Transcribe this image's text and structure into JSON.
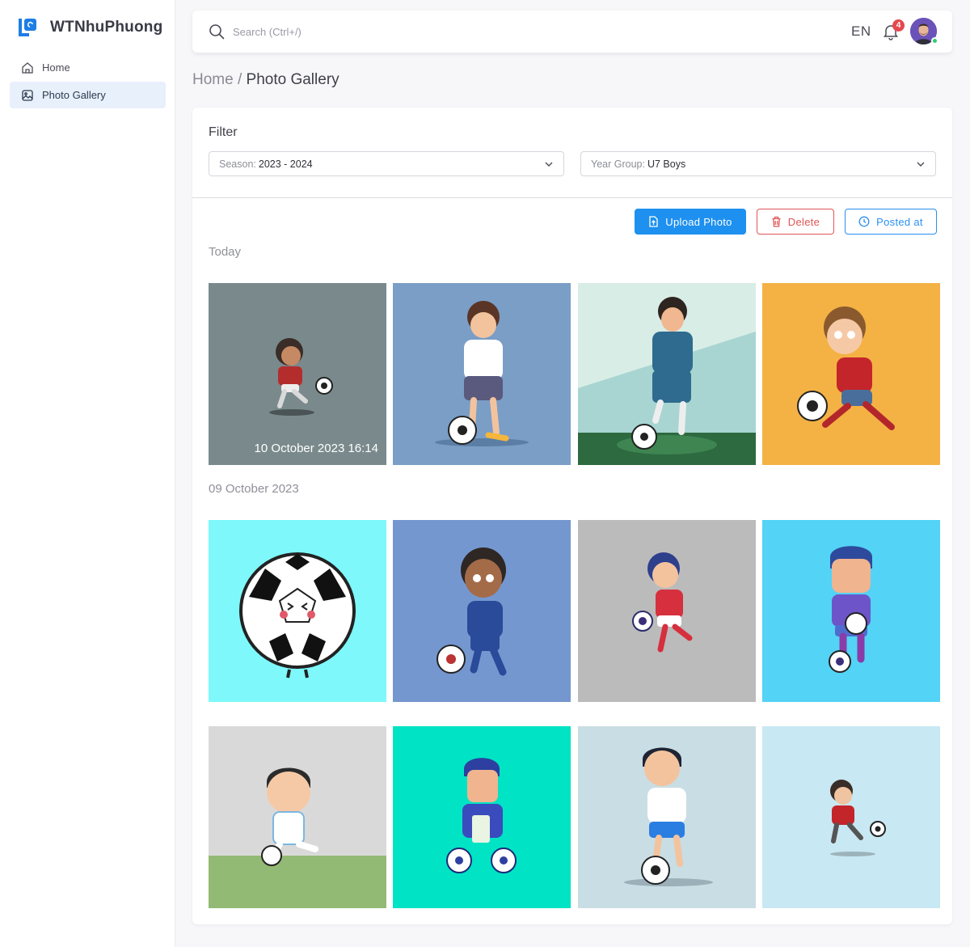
{
  "brand": {
    "name": "WTNhuPhuong",
    "accent": "#1e7ee6"
  },
  "sidebar": {
    "items": [
      {
        "label": "Home",
        "icon": "home-icon",
        "active": false
      },
      {
        "label": "Photo Gallery",
        "icon": "image-icon",
        "active": true
      }
    ]
  },
  "topbar": {
    "search_placeholder": "Search (Ctrl+/)",
    "language": "EN",
    "notification_count": "4"
  },
  "breadcrumb": {
    "root": "Home",
    "separator": " / ",
    "current": "Photo Gallery"
  },
  "filter": {
    "title": "Filter",
    "season": {
      "label": "Season:",
      "value": "2023 - 2024"
    },
    "year_group": {
      "label": "Year Group:",
      "value": "U7 Boys"
    }
  },
  "actions": {
    "upload": "Upload Photo",
    "delete": "Delete",
    "posted_at": "Posted at"
  },
  "groups": [
    {
      "label": "Today",
      "photos": [
        {
          "bg": "#7a8a8c",
          "caption": "10 October 2023 16:14"
        },
        {
          "bg": "#7a9ec6"
        },
        {
          "bg": "#d8ede6"
        },
        {
          "bg": "#f4b244"
        }
      ]
    },
    {
      "label": "09 October 2023",
      "photos": [
        {
          "bg": "#7ef8fb"
        },
        {
          "bg": "#7597cf"
        },
        {
          "bg": "#bbbbbb"
        },
        {
          "bg": "#53d3f5"
        },
        {
          "bg": "#d9d9d9"
        },
        {
          "bg": "#00e3c4"
        },
        {
          "bg": "#c9dde4"
        },
        {
          "bg": "#c8e8f3"
        }
      ]
    }
  ]
}
